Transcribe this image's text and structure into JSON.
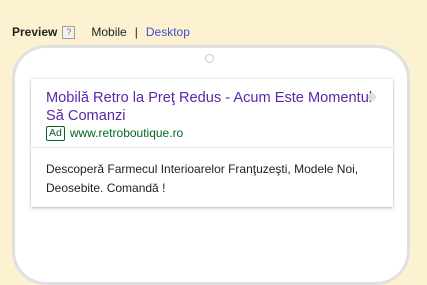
{
  "header": {
    "preview_label": "Preview",
    "help_icon_glyph": "?",
    "mobile_label": "Mobile",
    "separator": "|",
    "desktop_label": "Desktop"
  },
  "ad": {
    "title": "Mobilă Retro la Preţ Redus - Acum Este Momentul Să Comanzi",
    "badge": "Ad",
    "display_url": "www.retroboutique.ro",
    "description": "Descoperă Farmecul Interioarelor Franţuzeşti, Modele Noi, Deosebite. Comandă !"
  },
  "colors": {
    "page_background": "#fcf2d2",
    "ad_title": "#5a27a8",
    "ad_url": "#006621",
    "desktop_link": "#3c4fd0"
  }
}
